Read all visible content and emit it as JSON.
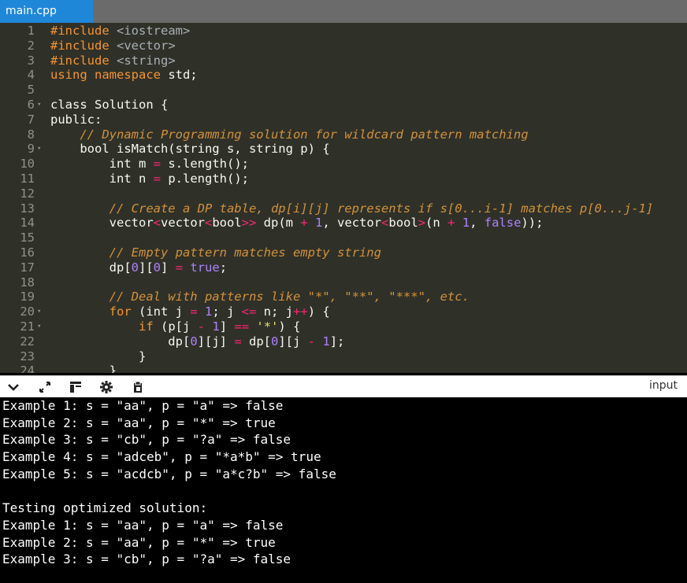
{
  "tab": {
    "label": "main.cpp"
  },
  "code": [
    {
      "n": "1",
      "fold": "",
      "segs": [
        [
          "pre",
          "#include "
        ],
        [
          "ang",
          "<iostream>"
        ]
      ]
    },
    {
      "n": "2",
      "fold": "",
      "segs": [
        [
          "pre",
          "#include "
        ],
        [
          "ang",
          "<vector>"
        ]
      ]
    },
    {
      "n": "3",
      "fold": "",
      "segs": [
        [
          "pre",
          "#include "
        ],
        [
          "ang",
          "<string>"
        ]
      ]
    },
    {
      "n": "4",
      "fold": "",
      "segs": [
        [
          "orange",
          "using namespace"
        ],
        [
          "kw",
          " std;"
        ]
      ]
    },
    {
      "n": "5",
      "fold": "",
      "segs": []
    },
    {
      "n": "6",
      "fold": "▾",
      "segs": [
        [
          "kw",
          "class Solution {"
        ]
      ]
    },
    {
      "n": "7",
      "fold": "",
      "segs": [
        [
          "kw",
          "public:"
        ]
      ]
    },
    {
      "n": "8",
      "fold": "",
      "segs": [
        [
          "kw",
          "    "
        ],
        [
          "cm",
          "// Dynamic Programming solution for wildcard pattern matching"
        ]
      ]
    },
    {
      "n": "9",
      "fold": "▾",
      "segs": [
        [
          "kw",
          "    bool isMatch(string s, string p) {"
        ]
      ]
    },
    {
      "n": "10",
      "fold": "",
      "segs": [
        [
          "kw",
          "        int m "
        ],
        [
          "op",
          "="
        ],
        [
          "kw",
          " s.length();"
        ]
      ]
    },
    {
      "n": "11",
      "fold": "",
      "segs": [
        [
          "kw",
          "        int n "
        ],
        [
          "op",
          "="
        ],
        [
          "kw",
          " p.length();"
        ]
      ]
    },
    {
      "n": "12",
      "fold": "",
      "segs": []
    },
    {
      "n": "13",
      "fold": "",
      "segs": [
        [
          "kw",
          "        "
        ],
        [
          "cm",
          "// Create a DP table, dp[i][j] represents if s[0...i-1] matches p[0...j-1]"
        ]
      ]
    },
    {
      "n": "14",
      "fold": "",
      "segs": [
        [
          "kw",
          "        vector"
        ],
        [
          "op",
          "<"
        ],
        [
          "kw",
          "vector"
        ],
        [
          "op",
          "<"
        ],
        [
          "kw",
          "bool"
        ],
        [
          "op",
          ">>"
        ],
        [
          "kw",
          " dp(m "
        ],
        [
          "op",
          "+"
        ],
        [
          "kw",
          " "
        ],
        [
          "num",
          "1"
        ],
        [
          "kw",
          ", vector"
        ],
        [
          "op",
          "<"
        ],
        [
          "kw",
          "bool"
        ],
        [
          "op",
          ">"
        ],
        [
          "kw",
          "(n "
        ],
        [
          "op",
          "+"
        ],
        [
          "kw",
          " "
        ],
        [
          "num",
          "1"
        ],
        [
          "kw",
          ", "
        ],
        [
          "bool",
          "false"
        ],
        [
          "kw",
          "));"
        ]
      ]
    },
    {
      "n": "15",
      "fold": "",
      "segs": []
    },
    {
      "n": "16",
      "fold": "",
      "segs": [
        [
          "kw",
          "        "
        ],
        [
          "cm",
          "// Empty pattern matches empty string"
        ]
      ]
    },
    {
      "n": "17",
      "fold": "",
      "segs": [
        [
          "kw",
          "        dp["
        ],
        [
          "num",
          "0"
        ],
        [
          "kw",
          "]["
        ],
        [
          "num",
          "0"
        ],
        [
          "kw",
          "] "
        ],
        [
          "op",
          "="
        ],
        [
          "kw",
          " "
        ],
        [
          "bool",
          "true"
        ],
        [
          "kw",
          ";"
        ]
      ]
    },
    {
      "n": "18",
      "fold": "",
      "segs": []
    },
    {
      "n": "19",
      "fold": "",
      "segs": [
        [
          "kw",
          "        "
        ],
        [
          "cm",
          "// Deal with patterns like \"*\", \"**\", \"***\", etc."
        ]
      ]
    },
    {
      "n": "20",
      "fold": "▾",
      "segs": [
        [
          "kw",
          "        "
        ],
        [
          "orange",
          "for"
        ],
        [
          "kw",
          " (int j "
        ],
        [
          "op",
          "="
        ],
        [
          "kw",
          " "
        ],
        [
          "num",
          "1"
        ],
        [
          "kw",
          "; j "
        ],
        [
          "op",
          "<="
        ],
        [
          "kw",
          " n; j"
        ],
        [
          "op",
          "++"
        ],
        [
          "kw",
          ") {"
        ]
      ]
    },
    {
      "n": "21",
      "fold": "▾",
      "segs": [
        [
          "kw",
          "            "
        ],
        [
          "orange",
          "if"
        ],
        [
          "kw",
          " (p[j "
        ],
        [
          "op",
          "-"
        ],
        [
          "kw",
          " "
        ],
        [
          "num",
          "1"
        ],
        [
          "kw",
          "] "
        ],
        [
          "op",
          "=="
        ],
        [
          "kw",
          " "
        ],
        [
          "chr",
          "'*'"
        ],
        [
          "kw",
          ") {"
        ]
      ]
    },
    {
      "n": "22",
      "fold": "",
      "segs": [
        [
          "kw",
          "                dp["
        ],
        [
          "num",
          "0"
        ],
        [
          "kw",
          "][j] "
        ],
        [
          "op",
          "="
        ],
        [
          "kw",
          " dp["
        ],
        [
          "num",
          "0"
        ],
        [
          "kw",
          "][j "
        ],
        [
          "op",
          "-"
        ],
        [
          "kw",
          " "
        ],
        [
          "num",
          "1"
        ],
        [
          "kw",
          "];"
        ]
      ]
    },
    {
      "n": "23",
      "fold": "",
      "segs": [
        [
          "kw",
          "            }"
        ]
      ]
    },
    {
      "n": "24",
      "fold": "",
      "segs": [
        [
          "kw",
          "        }"
        ]
      ]
    }
  ],
  "toolbar": {
    "icons": [
      "chevron-down-icon",
      "expand-icon",
      "layout-icon",
      "gear-icon",
      "clipboard-icon"
    ],
    "input_label": "input"
  },
  "console": [
    "Example 1: s = \"aa\", p = \"a\" => false",
    "Example 2: s = \"aa\", p = \"*\" => true",
    "Example 3: s = \"cb\", p = \"?a\" => false",
    "Example 4: s = \"adceb\", p = \"*a*b\" => true",
    "Example 5: s = \"acdcb\", p = \"a*c?b\" => false",
    "",
    "Testing optimized solution:",
    "Example 1: s = \"aa\", p = \"a\" => false",
    "Example 2: s = \"aa\", p = \"*\" => true",
    "Example 3: s = \"cb\", p = \"?a\" => false"
  ]
}
